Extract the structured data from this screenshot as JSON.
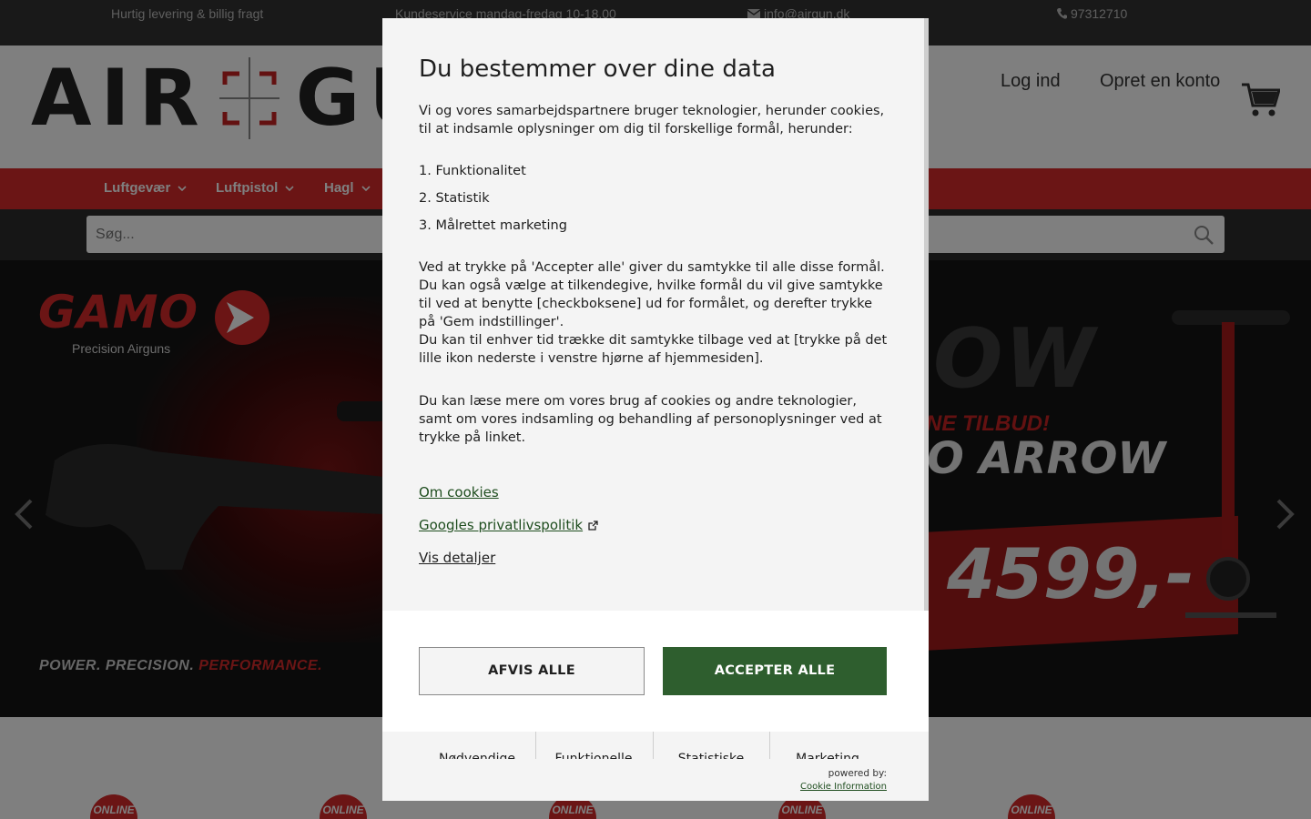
{
  "topbar": {
    "delivery": "Hurtig levering & billig fragt",
    "service": "Kundeservice mandag-fredag 10-18.00",
    "email": "info@airgun.dk",
    "phone": "97312710"
  },
  "header": {
    "logo_left": "AIR",
    "logo_right": "GUN",
    "login": "Log ind",
    "register": "Opret en konto"
  },
  "nav": {
    "items": [
      {
        "label": "Luftgevær"
      },
      {
        "label": "Luftpistol"
      },
      {
        "label": "Hagl"
      }
    ]
  },
  "search": {
    "placeholder": "Søg..."
  },
  "hero": {
    "brand": "GAMO",
    "brand_sub": "Precision Airguns",
    "tagline_a": "POWER. PRECISION.",
    "tagline_b": "PERFORMANCE.",
    "promo_a": "OW",
    "promo_b": "NE TILBUD!",
    "promo_c": "O ARROW",
    "promo_price": "4599,-"
  },
  "badges": {
    "label": "ONLINE"
  },
  "consent": {
    "title": "Du bestemmer over dine data",
    "intro": "Vi og vores samarbejdspartnere bruger teknologier, herunder cookies, til at indsamle oplysninger om dig til forskellige formål, herunder:",
    "purposes": [
      "1. Funktionalitet",
      "2. Statistik",
      "3. Målrettet marketing"
    ],
    "consent_text_1": "Ved at trykke på 'Accepter alle' giver du samtykke til alle disse formål. Du kan også vælge at tilkendegive, hvilke formål du vil give samtykke til ved at benytte [checkboksene] ud for formålet, og derefter trykke på 'Gem indstillinger'.",
    "consent_text_2": "Du kan til enhver tid trække dit samtykke tilbage ved at [trykke på det lille ikon nederste i venstre hjørne af hjemmesiden].",
    "consent_text_3": "Du kan læse mere om vores brug af cookies og andre teknologier, samt om vores indsamling og behandling af personoplysninger ved at trykke på linket.",
    "link_cookies": "Om cookies",
    "link_google": "Googles privatlivspolitik",
    "link_details": "Vis detaljer",
    "reject": "AFVIS ALLE",
    "accept": "ACCEPTER ALLE",
    "tabs": [
      "Nødvendige",
      "Funktionelle",
      "Statistiske",
      "Marketing"
    ],
    "powered_by": "powered by:",
    "provider": "Cookie Information"
  },
  "colors": {
    "brand_red": "#d62a2a",
    "accept_green": "#2e5e2e",
    "topbar": "#333333"
  }
}
